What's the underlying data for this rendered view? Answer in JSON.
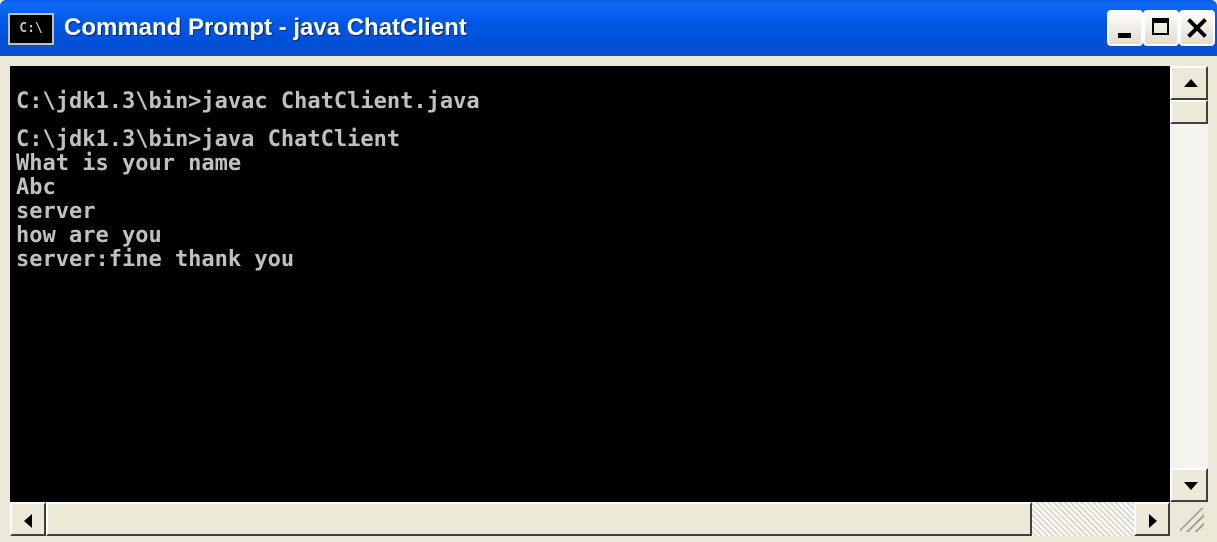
{
  "window": {
    "title": "Command Prompt - java ChatClient",
    "icon_text": "C:\\"
  },
  "console": {
    "lines": [
      "",
      "C:\\jdk1.3\\bin>javac ChatClient.java",
      "",
      "C:\\jdk1.3\\bin>java ChatClient",
      "What is your name",
      "Abc",
      "server",
      "how are you",
      "server:fine thank you"
    ]
  },
  "icons": {
    "title_icon": "console-icon",
    "minimize": "minimize-icon",
    "maximize": "maximize-icon",
    "close": "close-icon",
    "scroll_up": "arrow-up-icon",
    "scroll_down": "arrow-down-icon",
    "scroll_left": "arrow-left-icon",
    "scroll_right": "arrow-right-icon",
    "resize": "size-grip-icon"
  },
  "colors": {
    "titlebar": "#0058E6",
    "console_background": "#000000",
    "console_text": "#C0C0C0",
    "close_button": "#C9432A"
  }
}
